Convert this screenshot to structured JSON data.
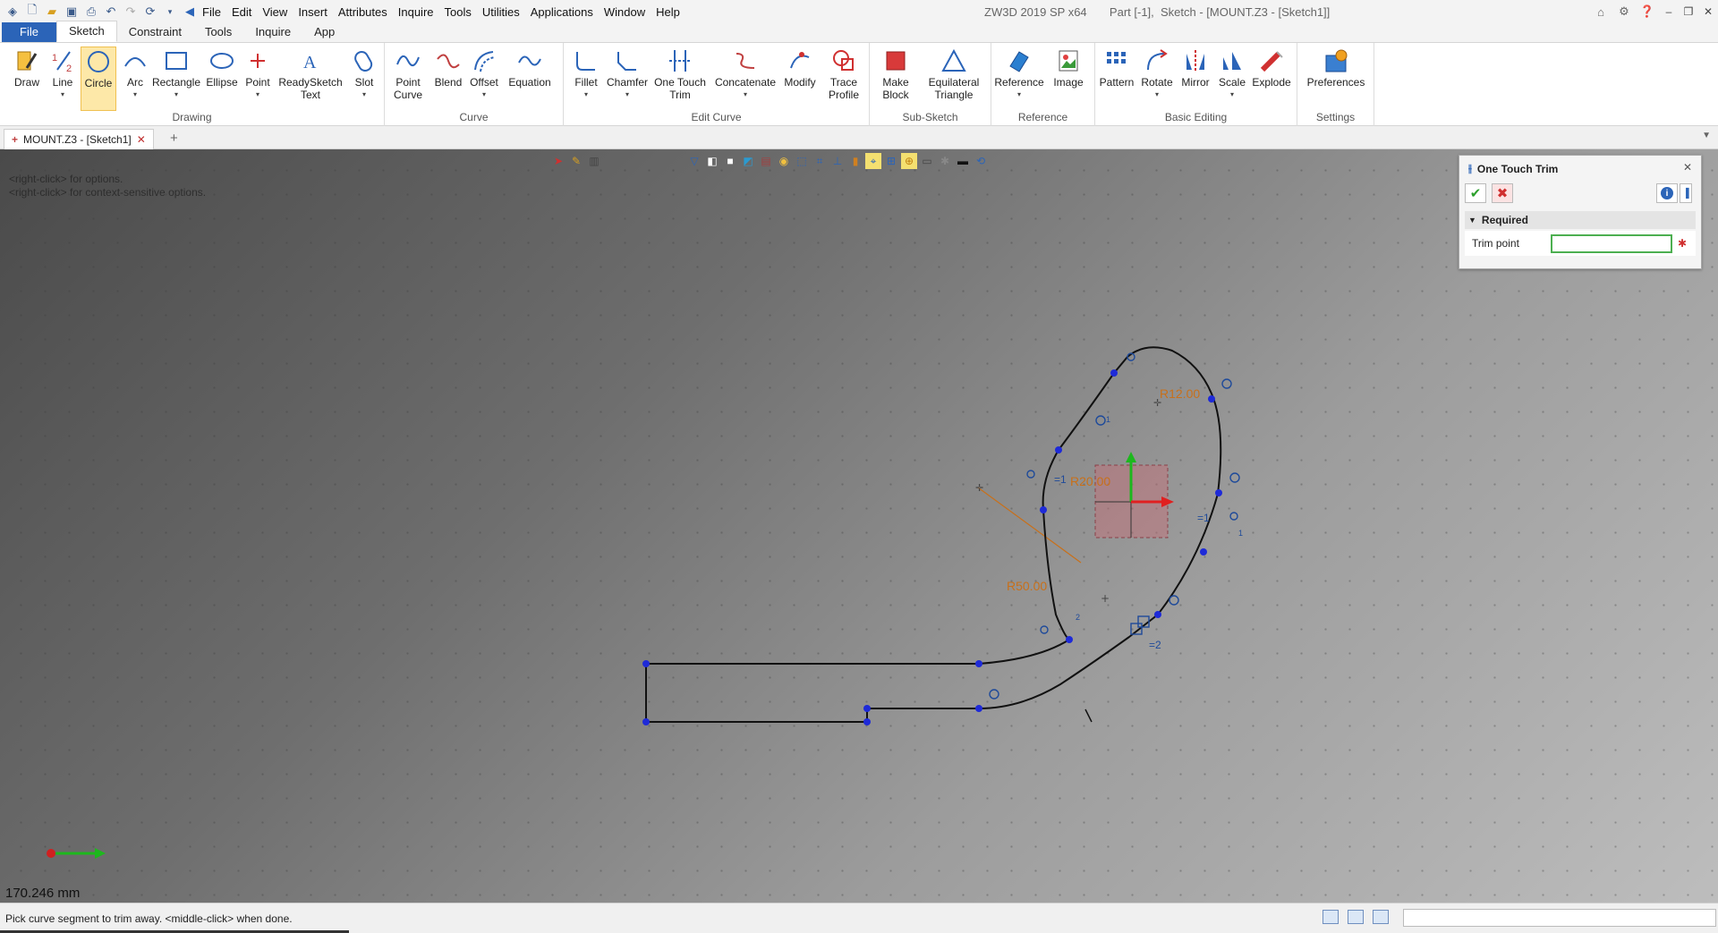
{
  "app": {
    "title": "ZW3D 2019 SP x64       Part [-1],  Sketch - [MOUNT.Z3 - [Sketch1]]"
  },
  "menu": [
    "File",
    "Edit",
    "View",
    "Insert",
    "Attributes",
    "Inquire",
    "Tools",
    "Utilities",
    "Applications",
    "Window",
    "Help"
  ],
  "ribbon_tabs": [
    "File",
    "Sketch",
    "Constraint",
    "Tools",
    "Inquire",
    "App"
  ],
  "active_ribbon_tab": "Sketch",
  "ribbon": {
    "drawing": {
      "label": "Drawing",
      "buttons": [
        "Draw",
        "Line",
        "Circle",
        "Arc",
        "Rectangle",
        "Ellipse",
        "Point",
        "ReadySketch\nText",
        "Slot"
      ]
    },
    "curve": {
      "label": "Curve",
      "buttons": [
        "Point\nCurve",
        "Blend",
        "Offset",
        "Equation"
      ]
    },
    "edit_curve": {
      "label": "Edit Curve",
      "buttons": [
        "Fillet",
        "Chamfer",
        "One Touch\nTrim",
        "Concatenate",
        "Modify",
        "Trace\nProfile"
      ]
    },
    "sub_sketch": {
      "label": "Sub-Sketch",
      "buttons": [
        "Make\nBlock",
        "Equilateral\nTriangle"
      ]
    },
    "reference": {
      "label": "Reference",
      "buttons": [
        "Reference",
        "Image"
      ]
    },
    "basic_editing": {
      "label": "Basic Editing",
      "buttons": [
        "Pattern",
        "Rotate",
        "Mirror",
        "Scale",
        "Explode"
      ]
    },
    "settings": {
      "label": "Settings",
      "buttons": [
        "Preferences"
      ]
    }
  },
  "doc_tab": {
    "label": "MOUNT.Z3 - [Sketch1]"
  },
  "canvas": {
    "hint_line1": "<right-click> for options.",
    "hint_line2": "<right-click> for context-sensitive options.",
    "coordinate_readout": "170.246 mm",
    "dimensions": {
      "r12": "R12.00",
      "r20": "R20.00",
      "r50": "R50.00"
    },
    "constraint_labels": {
      "eq1a": "=1",
      "eq1b": "=1",
      "eq2": "=2",
      "o1a": "1",
      "o1b": "1",
      "x2": "2"
    }
  },
  "panel": {
    "title": "One Touch Trim",
    "section": "Required",
    "field_label": "Trim point",
    "field_value": ""
  },
  "status": {
    "text": "Pick curve segment to trim away.  <middle-click> when done."
  },
  "colors": {
    "file_tab": "#2b64b8",
    "dimension": "#c8701a",
    "constraint": "#1e4a9a",
    "sketch_point": "#1e2ad8",
    "accept": "#2da02d",
    "cancel": "#d03030"
  }
}
